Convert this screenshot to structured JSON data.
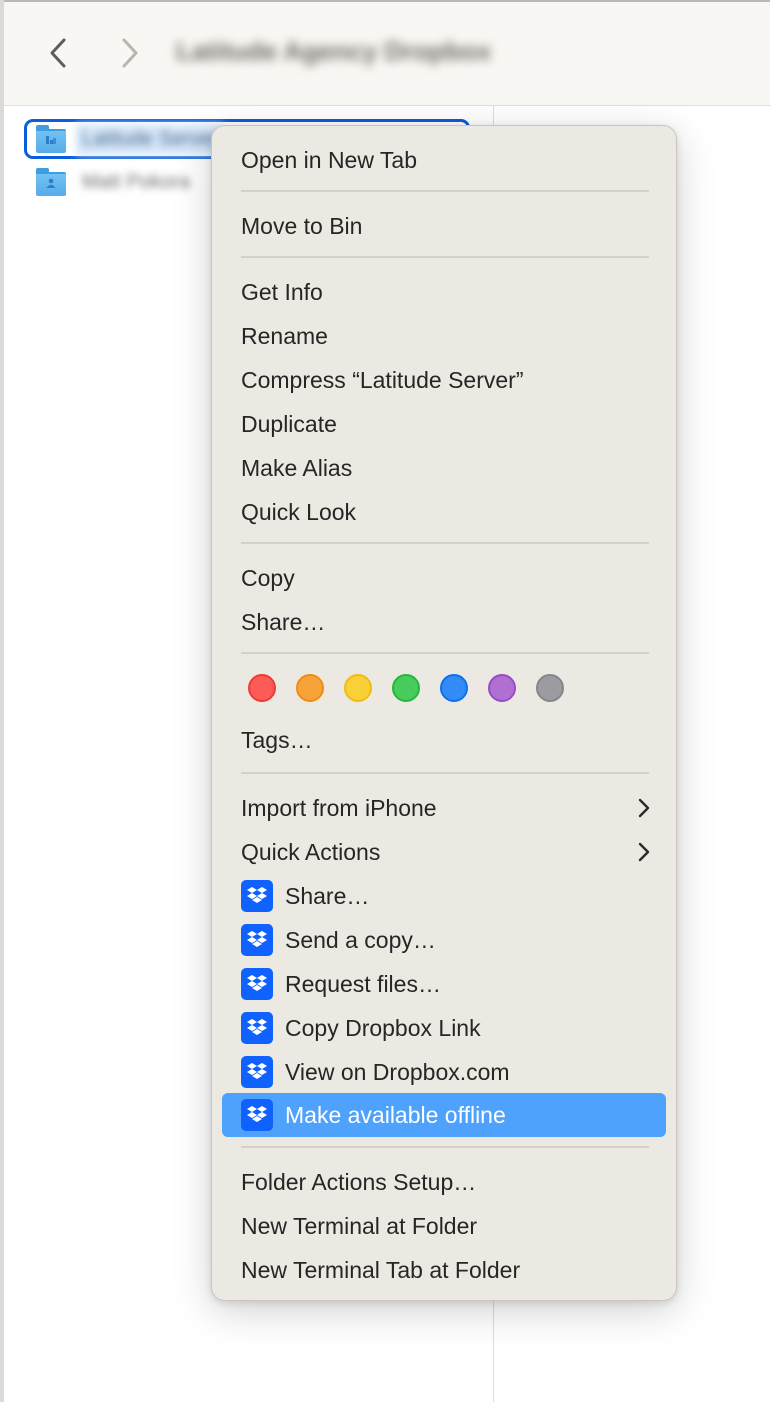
{
  "window": {
    "title": "Latitude Agency Dropbox"
  },
  "toolbar": {
    "back_label": "Back",
    "forward_label": "Forward"
  },
  "files": [
    {
      "name": "Latitude Server",
      "type": "folder",
      "icon": "shared-folder-icon",
      "selected": true
    },
    {
      "name": "Matt Pokora",
      "type": "folder",
      "icon": "user-folder-icon",
      "selected": false
    }
  ],
  "context_menu": {
    "groups": [
      {
        "items": [
          {
            "label": "Open in New Tab"
          }
        ]
      },
      {
        "items": [
          {
            "label": "Move to Bin"
          }
        ]
      },
      {
        "items": [
          {
            "label": "Get Info"
          },
          {
            "label": "Rename"
          },
          {
            "label": "Compress “Latitude Server”"
          },
          {
            "label": "Duplicate"
          },
          {
            "label": "Make Alias"
          },
          {
            "label": "Quick Look"
          }
        ]
      },
      {
        "items": [
          {
            "label": "Copy"
          },
          {
            "label": "Share…"
          }
        ]
      },
      {
        "tags": [
          {
            "name": "Red",
            "color": "#fc5b57",
            "border": "#ee3b36"
          },
          {
            "name": "Orange",
            "color": "#f8a33a",
            "border": "#f08d10"
          },
          {
            "name": "Yellow",
            "color": "#f8d138",
            "border": "#f1bc0f"
          },
          {
            "name": "Green",
            "color": "#49cc5e",
            "border": "#24b83b"
          },
          {
            "name": "Blue",
            "color": "#338bf6",
            "border": "#0d70ef"
          },
          {
            "name": "Purple",
            "color": "#b070d2",
            "border": "#9a4cc7"
          },
          {
            "name": "Gray",
            "color": "#9c9b9f",
            "border": "#86858a"
          }
        ],
        "items": [
          {
            "label": "Tags…"
          }
        ]
      },
      {
        "items": [
          {
            "label": "Import from iPhone",
            "submenu": true
          },
          {
            "label": "Quick Actions",
            "submenu": true
          },
          {
            "label": "Share…",
            "icon": "dropbox-icon"
          },
          {
            "label": "Send a copy…",
            "icon": "dropbox-icon"
          },
          {
            "label": "Request files…",
            "icon": "dropbox-icon"
          },
          {
            "label": "Copy Dropbox Link",
            "icon": "dropbox-icon"
          },
          {
            "label": "View on Dropbox.com",
            "icon": "dropbox-icon"
          },
          {
            "label": "Make available offline",
            "icon": "dropbox-icon",
            "highlighted": true
          }
        ]
      },
      {
        "items": [
          {
            "label": "Folder Actions Setup…"
          },
          {
            "label": "New Terminal at Folder"
          },
          {
            "label": "New Terminal Tab at Folder"
          }
        ]
      }
    ]
  },
  "colors": {
    "selection_outline": "#0a5ddc",
    "menu_highlight": "#4ea2fb",
    "dropbox_blue": "#0f62fe",
    "menu_background": "#ece9e3"
  }
}
